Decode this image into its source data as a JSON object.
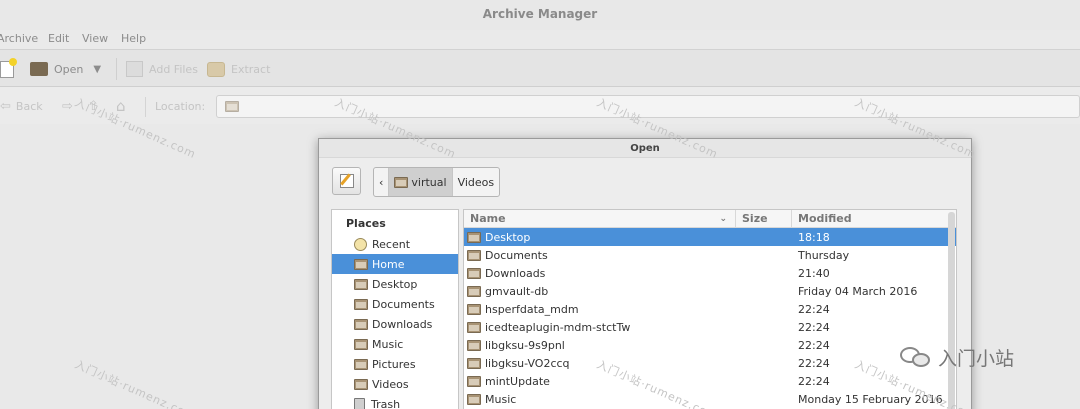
{
  "window": {
    "title": "Archive Manager"
  },
  "menu": [
    "Archive",
    "Edit",
    "View",
    "Help"
  ],
  "toolbar": {
    "open_label": "Open",
    "add_files_label": "Add Files",
    "extract_label": "Extract"
  },
  "location": {
    "back_label": "Back",
    "location_label": "Location:"
  },
  "dialog": {
    "title": "Open",
    "path": [
      "virtual",
      "Videos"
    ],
    "places_header": "Places",
    "places": [
      {
        "label": "Recent",
        "icon": "clock-icon"
      },
      {
        "label": "Home",
        "icon": "home-folder-icon"
      },
      {
        "label": "Desktop",
        "icon": "folder-icon"
      },
      {
        "label": "Documents",
        "icon": "folder-icon"
      },
      {
        "label": "Downloads",
        "icon": "folder-icon"
      },
      {
        "label": "Music",
        "icon": "folder-icon"
      },
      {
        "label": "Pictures",
        "icon": "folder-icon"
      },
      {
        "label": "Videos",
        "icon": "folder-icon"
      },
      {
        "label": "Trash",
        "icon": "trash-icon"
      }
    ],
    "columns": {
      "name": "Name",
      "size": "Size",
      "modified": "Modified"
    },
    "files": [
      {
        "name": "Desktop",
        "size": "",
        "modified": "18:18"
      },
      {
        "name": "Documents",
        "size": "",
        "modified": "Thursday"
      },
      {
        "name": "Downloads",
        "size": "",
        "modified": "21:40"
      },
      {
        "name": "gmvault-db",
        "size": "",
        "modified": "Friday 04 March 2016"
      },
      {
        "name": "hsperfdata_mdm",
        "size": "",
        "modified": "22:24"
      },
      {
        "name": "icedteaplugin-mdm-stctTw",
        "size": "",
        "modified": "22:24"
      },
      {
        "name": "libgksu-9s9pnl",
        "size": "",
        "modified": "22:24"
      },
      {
        "name": "libgksu-VO2ccq",
        "size": "",
        "modified": "22:24"
      },
      {
        "name": "mintUpdate",
        "size": "",
        "modified": "22:24"
      },
      {
        "name": "Music",
        "size": "",
        "modified": "Monday 15 February 2016"
      }
    ]
  },
  "watermark": {
    "text": "入门小站·rumenz.com",
    "badge": "入门小站"
  }
}
